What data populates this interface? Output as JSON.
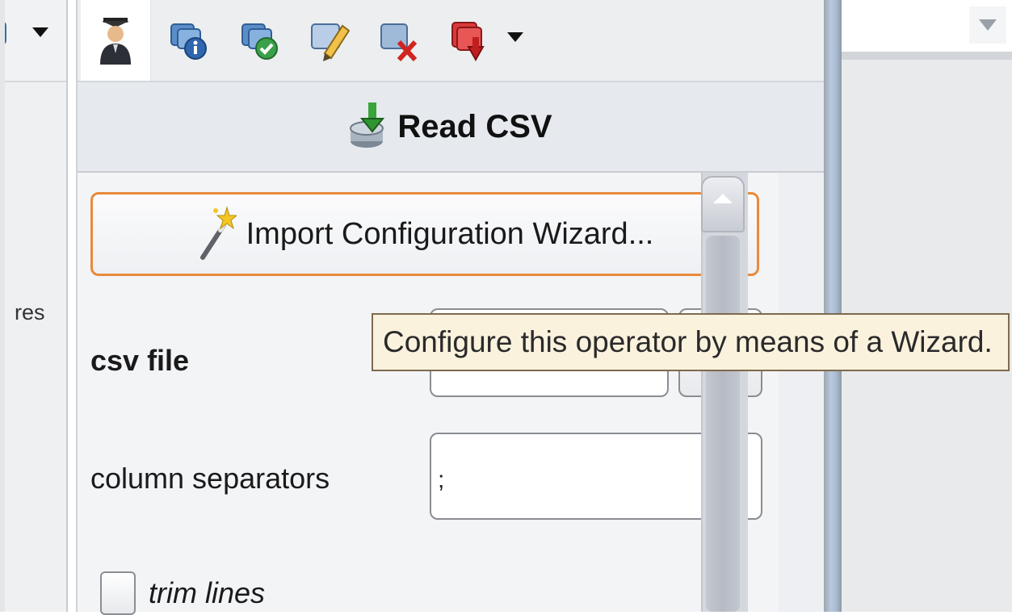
{
  "left_panel": {
    "label_fragment": "res"
  },
  "toolbar": {
    "icons": [
      "teacher-icon",
      "info-icon",
      "check-icon",
      "edit-icon",
      "delete-icon",
      "export-icon"
    ]
  },
  "operator": {
    "title": "Read CSV",
    "icon": "import-csv-icon"
  },
  "params": {
    "wizard_button_label": "Import Configuration Wizard...",
    "csv_file_label": "csv file",
    "csv_file_value": "",
    "column_separators_label": "column separators",
    "column_separators_value": ";",
    "trim_lines_label": "trim lines",
    "trim_lines_checked": false
  },
  "tooltip": {
    "text": "Configure this operator by means of a Wizard."
  },
  "colors": {
    "wizard_border": "#e88a3c",
    "tooltip_bg": "#fbf2de"
  }
}
